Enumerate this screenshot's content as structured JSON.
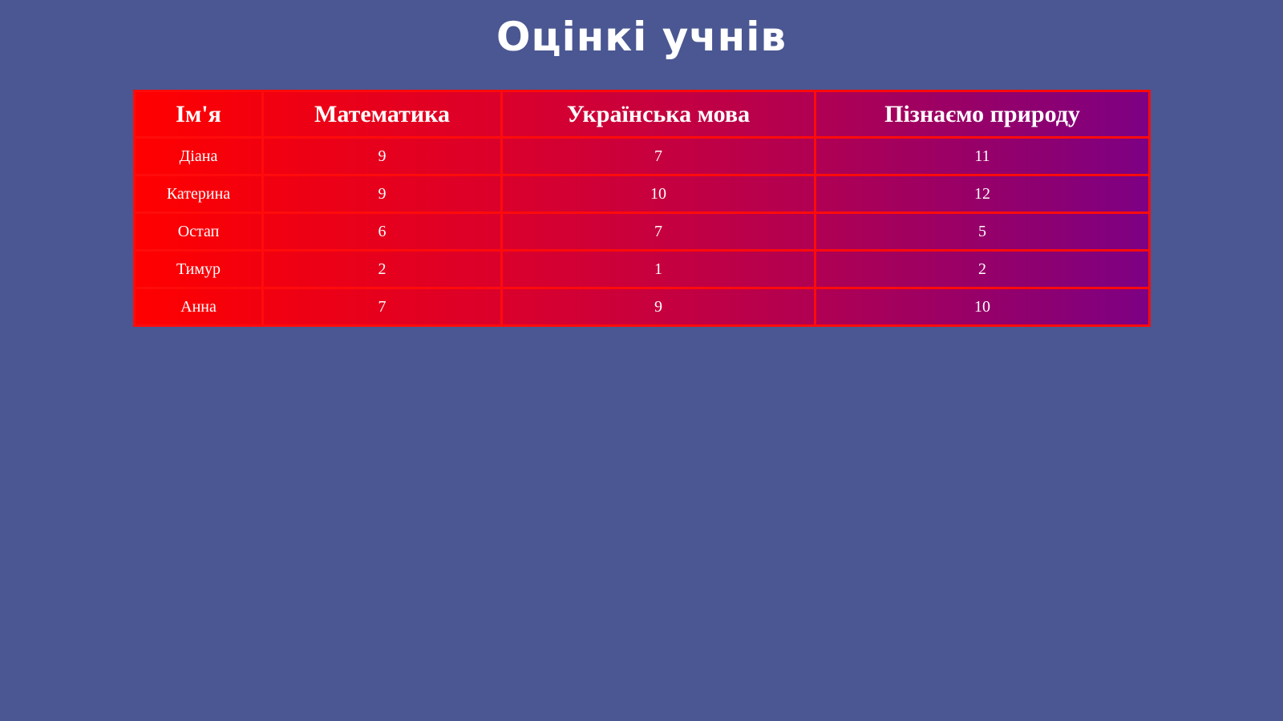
{
  "page": {
    "title": "Оцінкі учнів"
  },
  "colors": {
    "background": "#4a5792",
    "table_border": "#ff0b0b",
    "gradient_start": "#ff0000",
    "gradient_end": "#7d0084",
    "text": "#ffffff"
  },
  "table": {
    "headers": [
      "Ім'я",
      "Математика",
      "Українська мова",
      "Пізнаємо природу"
    ],
    "rows": [
      {
        "name": "Діана",
        "math": "9",
        "ukrainian": "7",
        "nature": "11"
      },
      {
        "name": "Катерина",
        "math": "9",
        "ukrainian": "10",
        "nature": "12"
      },
      {
        "name": "Остап",
        "math": "6",
        "ukrainian": "7",
        "nature": "5"
      },
      {
        "name": "Тимур",
        "math": "2",
        "ukrainian": "1",
        "nature": "2"
      },
      {
        "name": "Анна",
        "math": "7",
        "ukrainian": "9",
        "nature": "10"
      }
    ]
  }
}
